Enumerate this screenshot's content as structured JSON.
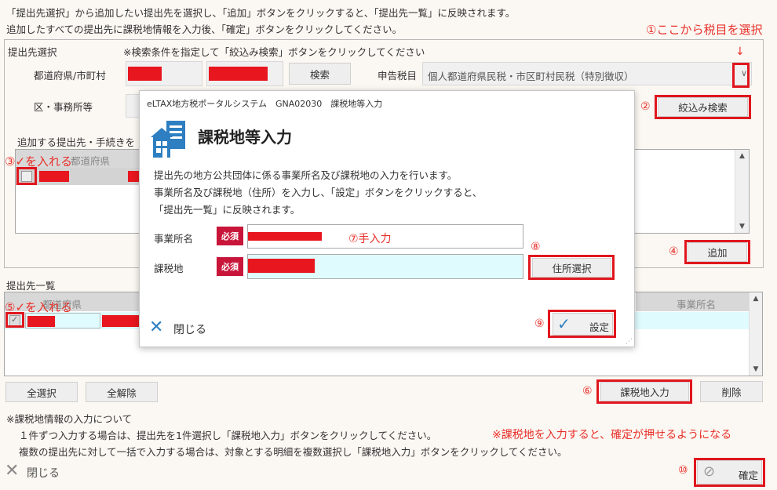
{
  "intro": {
    "line1": "「提出先選択」から追加したい提出先を選択し、「追加」ボタンをクリックすると、「提出先一覧」に反映されます。",
    "line2": "追加したすべての提出先に課税地情報を入力後、「確定」ボタンをクリックしてください。"
  },
  "select_section": {
    "title": "提出先選択",
    "hint": "※検索条件を指定して「絞込み検索」ボタンをクリックしてください",
    "pref_label": "都道府県/市町村",
    "search_label": "検索",
    "tax_label": "申告税目",
    "tax_value": "個人都道府県民税・市区町村民税（特別徴収）",
    "ward_label": "区・事務所等",
    "filter_label": "絞込み検索",
    "list_title": "追加する提出先・手続きを",
    "col_pref": "都道府県",
    "add_label": "追加"
  },
  "list_section": {
    "title": "提出先一覧",
    "col_pref": "都道府県",
    "col_office": "事業所名"
  },
  "buttons": {
    "select_all": "全選択",
    "deselect_all": "全解除",
    "tax_input": "課税地入力",
    "delete": "削除",
    "close": "閉じる",
    "confirm": "確定"
  },
  "notes": {
    "title": "※課税地情報の入力について",
    "line1": "１件ずつ入力する場合は、提出先を1件選択し「課税地入力」ボタンをクリックしてください。",
    "line2": "複数の提出先に対して一括で入力する場合は、対象とする明細を複数選択し「課税地入力」ボタンをクリックしてください。"
  },
  "modal": {
    "titlebar": "eLTAX地方税ポータルシステム　GNA02030　課税地等入力",
    "heading": "課税地等入力",
    "desc1": "提出先の地方公共団体に係る事業所名及び課税地の入力を行います。",
    "desc2": "事業所名及び課税地（住所）を入力し、「設定」ボタンをクリックすると、",
    "desc3": "「提出先一覧」に反映されます。",
    "office_label": "事業所名",
    "taxplace_label": "課税地",
    "required": "必須",
    "address_btn": "住所選択",
    "close": "閉じる",
    "set": "設定"
  },
  "annotations": {
    "a1": "①ここから税目を選択",
    "a2": "②",
    "a3": "③✓を入れる",
    "a4": "④",
    "a5": "⑤✓を入れる",
    "a6": "⑥",
    "a7": "⑦手入力",
    "a8": "⑧",
    "a9": "⑨",
    "a10": "⑩",
    "note": "※課税地を入力すると、確定が押せるようになる",
    "arrow": "↓"
  },
  "colors": {
    "annotation_red": "#e0161e",
    "required_badge": "#c8163a",
    "highlight_cyan": "#e0fbfd",
    "icon_blue": "#2e7fc1"
  }
}
